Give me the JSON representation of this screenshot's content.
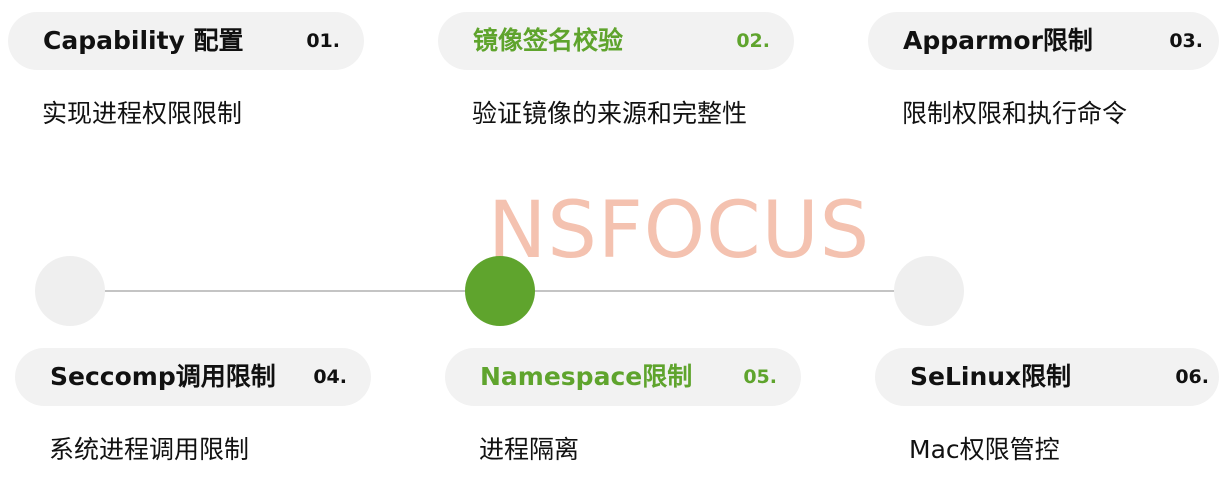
{
  "watermark": "NSFOCUS",
  "colors": {
    "accent": "#5fa42d",
    "pill": "#f2f2f2",
    "node": "#efefef",
    "line": "#c4c4c4",
    "watermark": "#f4c2b0"
  },
  "items": [
    {
      "title": "Capability 配置",
      "num": "01.",
      "desc": "实现进程权限限制"
    },
    {
      "title": "镜像签名校验",
      "num": "02.",
      "desc": "验证镜像的来源和完整性"
    },
    {
      "title": "Apparmor限制",
      "num": "03.",
      "desc": "限制权限和执行命令"
    },
    {
      "title": "Seccomp调用限制",
      "num": "04.",
      "desc": "系统进程调用限制"
    },
    {
      "title": "Namespace限制",
      "num": "05.",
      "desc": "进程隔离"
    },
    {
      "title": "SeLinux限制",
      "num": "06.",
      "desc": "Mac权限管控"
    }
  ]
}
